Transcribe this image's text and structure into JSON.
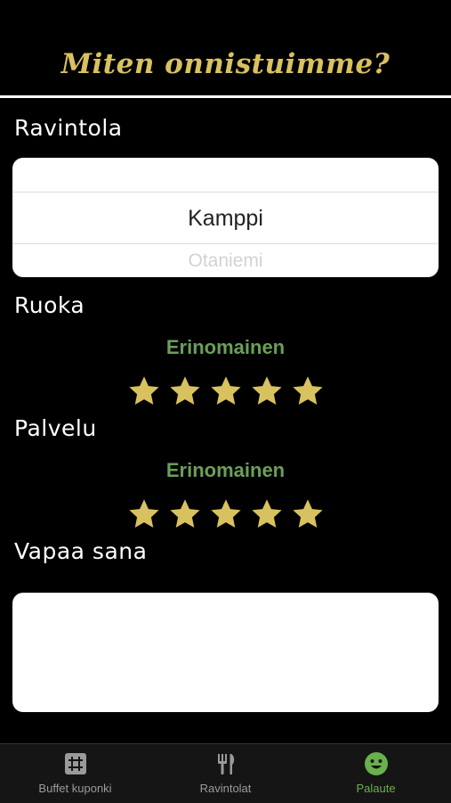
{
  "header": {
    "title": "Miten onnistuimme?"
  },
  "restaurant": {
    "label": "Ravintola",
    "selected": "Kamppi",
    "next": "Otaniemi"
  },
  "food": {
    "label": "Ruoka",
    "rating_text": "Erinomainen",
    "stars": 5,
    "max_stars": 5
  },
  "service": {
    "label": "Palvelu",
    "rating_text": "Erinomainen",
    "stars": 5,
    "max_stars": 5
  },
  "free_text": {
    "label": "Vapaa sana",
    "value": ""
  },
  "tabbar": {
    "items": [
      {
        "label": "Buffet kuponki",
        "icon": "grid-icon"
      },
      {
        "label": "Ravintolat",
        "icon": "fork-knife-icon"
      },
      {
        "label": "Palaute",
        "icon": "smiley-icon"
      }
    ],
    "active_index": 2
  },
  "colors": {
    "background": "#000000",
    "title": "#d8c15f",
    "star": "#d8c15f",
    "rating_text": "#6a9f58",
    "active_tab": "#6ab04c",
    "inactive_tab": "#9a9a9a"
  }
}
